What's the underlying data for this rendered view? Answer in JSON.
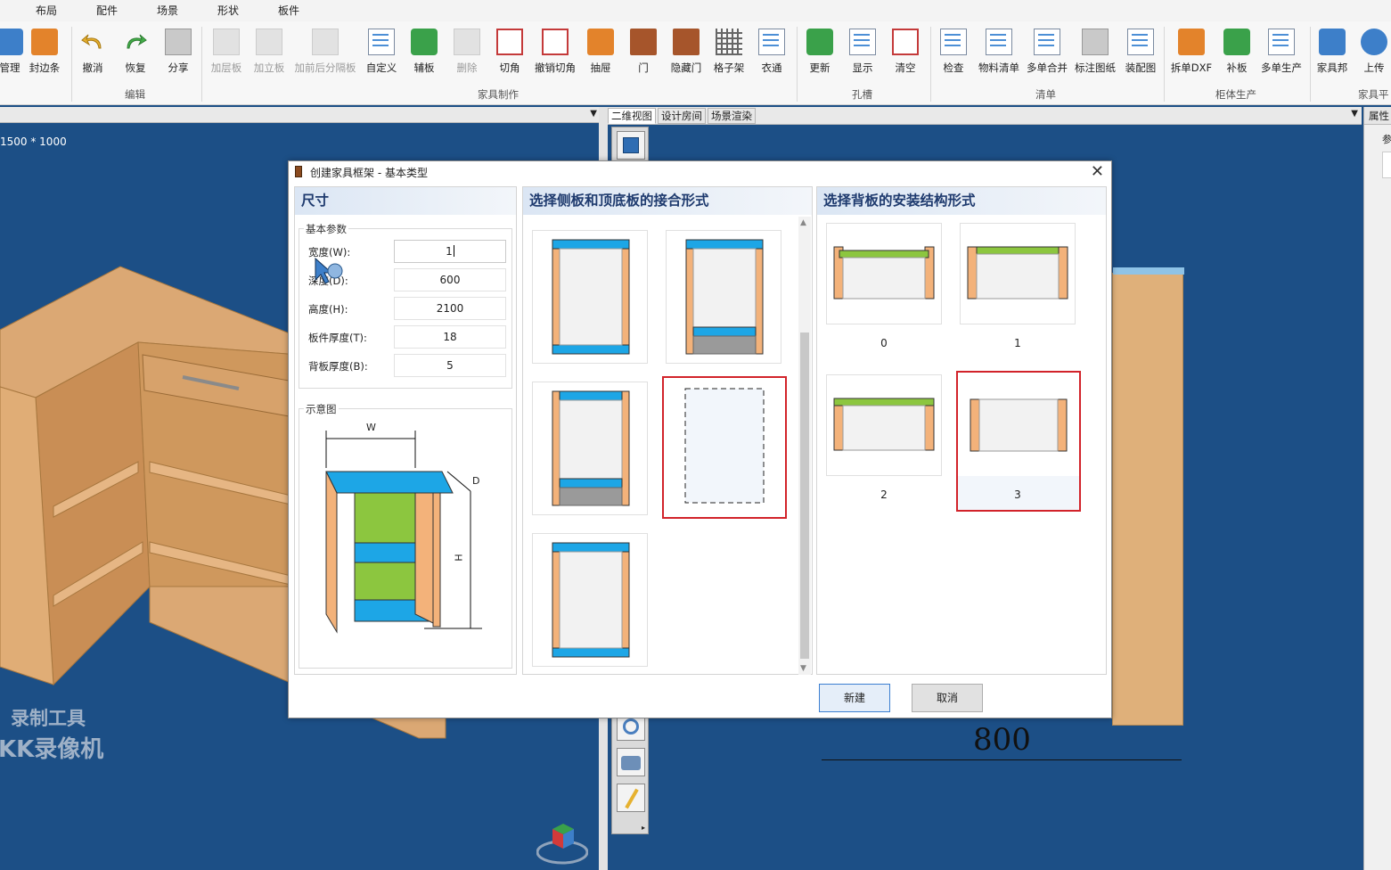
{
  "menu": [
    "布局",
    "配件",
    "场景",
    "形状",
    "板件"
  ],
  "ribbon": {
    "buttons": [
      {
        "label": "管理",
        "icon": "manage-icon",
        "disabled": false
      },
      {
        "label": "封边条",
        "icon": "edge-band-icon",
        "disabled": false
      },
      {
        "label": "撤消",
        "icon": "undo-icon",
        "disabled": false
      },
      {
        "label": "恢复",
        "icon": "redo-icon",
        "disabled": false
      },
      {
        "label": "分享",
        "icon": "share-icon",
        "disabled": false
      },
      {
        "label": "加层板",
        "icon": "add-shelf-icon",
        "disabled": true
      },
      {
        "label": "加立板",
        "icon": "add-vertical-board-icon",
        "disabled": true
      },
      {
        "label": "加前后分隔板",
        "icon": "add-divider-icon",
        "disabled": true
      },
      {
        "label": "自定义",
        "icon": "custom-icon",
        "disabled": false
      },
      {
        "label": "辅板",
        "icon": "aux-board-icon",
        "disabled": false
      },
      {
        "label": "删除",
        "icon": "delete-icon",
        "disabled": true
      },
      {
        "label": "切角",
        "icon": "cut-corner-icon",
        "disabled": false
      },
      {
        "label": "撤销切角",
        "icon": "undo-cut-corner-icon",
        "disabled": false
      },
      {
        "label": "抽屉",
        "icon": "drawer-icon",
        "disabled": false
      },
      {
        "label": "门",
        "icon": "door-icon",
        "disabled": false
      },
      {
        "label": "隐藏门",
        "icon": "hidden-door-icon",
        "disabled": false
      },
      {
        "label": "格子架",
        "icon": "grid-rack-icon",
        "disabled": false
      },
      {
        "label": "衣通",
        "icon": "hanging-rod-icon",
        "disabled": false
      },
      {
        "label": "更新",
        "icon": "update-icon",
        "disabled": false
      },
      {
        "label": "显示",
        "icon": "display-icon",
        "disabled": false
      },
      {
        "label": "清空",
        "icon": "clear-icon",
        "disabled": false
      },
      {
        "label": "检查",
        "icon": "check-icon",
        "disabled": false
      },
      {
        "label": "物料清单",
        "icon": "material-list-icon",
        "disabled": false
      },
      {
        "label": "多单合并",
        "icon": "merge-orders-icon",
        "disabled": false
      },
      {
        "label": "标注图纸",
        "icon": "dwg-annotate-icon",
        "disabled": false
      },
      {
        "label": "装配图",
        "icon": "assembly-drawing-icon",
        "disabled": false
      },
      {
        "label": "拆单DXF",
        "icon": "dxf-split-icon",
        "disabled": false
      },
      {
        "label": "补板",
        "icon": "patch-board-icon",
        "disabled": false
      },
      {
        "label": "多单生产",
        "icon": "multi-production-icon",
        "disabled": false
      },
      {
        "label": "家具邦",
        "icon": "furniture-bang-icon",
        "disabled": false
      },
      {
        "label": "上传",
        "icon": "upload-icon",
        "disabled": false
      }
    ],
    "groups": [
      "编辑",
      "家具制作",
      "孔槽",
      "清单",
      "柜体生产",
      "家具平"
    ]
  },
  "left_view": {
    "size_label": "1500 * 1000"
  },
  "view_tabs": [
    "二维视图",
    "设计房间",
    "场景渲染"
  ],
  "prop_panel": {
    "title": "属性",
    "subtitle": "参"
  },
  "drawing": {
    "dimension": "800",
    "partial_digit": "8"
  },
  "watermark": {
    "line1": "录制工具",
    "line2": "KK录像机"
  },
  "dialog": {
    "title": "创建家具框架 - 基本类型",
    "close": "✕",
    "size_panel": {
      "heading": "尺寸",
      "group_label": "基本参数",
      "fields": [
        {
          "label": "宽度(W):",
          "value": "1"
        },
        {
          "label": "深度(D):",
          "value": "600"
        },
        {
          "label": "高度(H):",
          "value": "2100"
        },
        {
          "label": "板件厚度(T):",
          "value": "18"
        },
        {
          "label": "背板厚度(B):",
          "value": "5"
        }
      ],
      "diagram_label": "示意图",
      "diagram_marks": {
        "w": "W",
        "d": "D",
        "h": "H"
      }
    },
    "joint_panel": {
      "heading": "选择侧板和顶底板的接合形式",
      "selected": 3
    },
    "back_panel": {
      "heading": "选择背板的安装结构形式",
      "options": [
        "0",
        "1",
        "2",
        "3"
      ],
      "selected": 3
    },
    "buttons": {
      "create": "新建",
      "cancel": "取消"
    }
  },
  "colors": {
    "workspace": "#1c4f86",
    "side_board": "#f3b27a",
    "top_board": "#1da6e6",
    "back_board": "#8cc63f",
    "selection": "#d2232a",
    "heading": "#1e3a6e"
  }
}
